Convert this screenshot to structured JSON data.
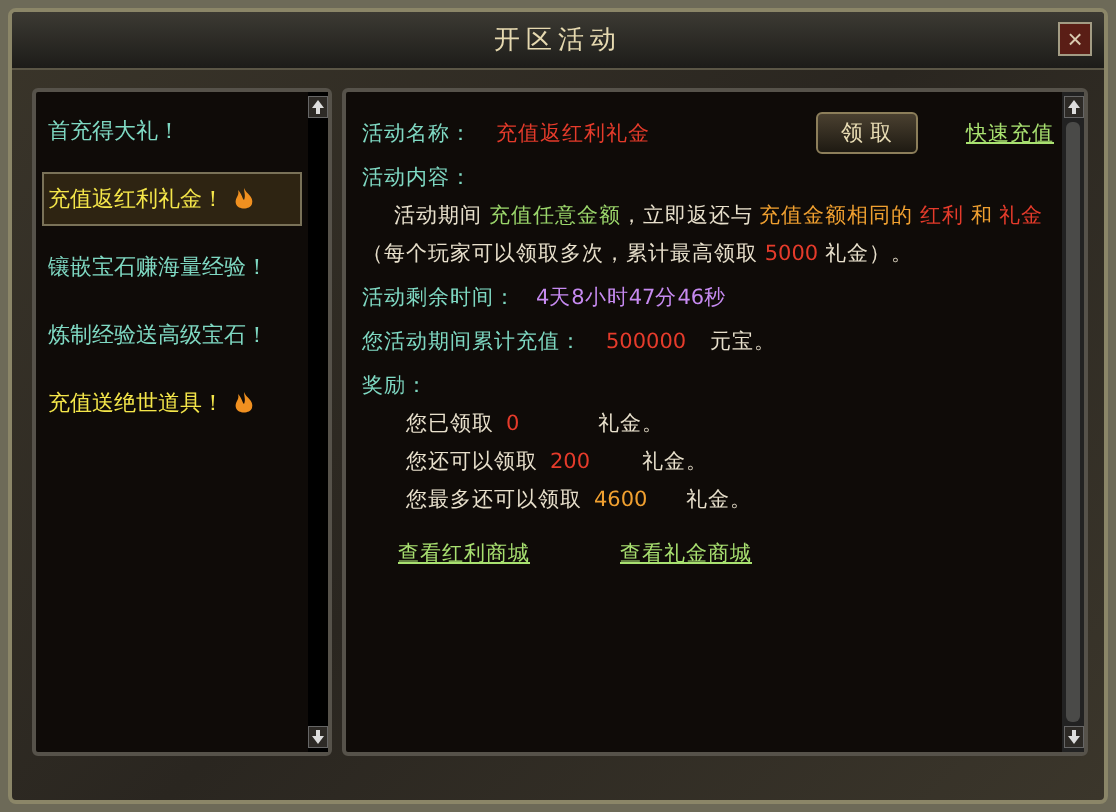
{
  "window": {
    "title": "开区活动",
    "close": "×"
  },
  "sidebar": {
    "items": [
      {
        "label": "首充得大礼！",
        "selected": false,
        "hot": false
      },
      {
        "label": "充值返红利礼金！",
        "selected": true,
        "hot": true
      },
      {
        "label": "镶嵌宝石赚海量经验！",
        "selected": false,
        "hot": false
      },
      {
        "label": "炼制经验送高级宝石！",
        "selected": false,
        "hot": false
      },
      {
        "label": "充值送绝世道具！",
        "selected": false,
        "hot": true
      }
    ]
  },
  "detail": {
    "name_label": "活动名称：",
    "name_value": "充值返红利礼金",
    "claim_button": "领 取",
    "quick_recharge": "快速充值",
    "content_label": "活动内容：",
    "content_lines": [
      [
        {
          "text": "活动期间 ",
          "kind": "plain"
        },
        {
          "text": "充值任意金额",
          "kind": "green"
        },
        {
          "text": "，立即返还与 ",
          "kind": "plain"
        },
        {
          "text": "充值金额相同的 ",
          "kind": "orange"
        },
        {
          "text": "红利",
          "kind": "red"
        },
        {
          "text": " 和 ",
          "kind": "orange"
        },
        {
          "text": "礼金",
          "kind": "red"
        }
      ],
      [
        {
          "text": "（每个玩家可以领取多次，累计最高领取 ",
          "kind": "plain"
        },
        {
          "text": "5000",
          "kind": "red"
        },
        {
          "text": " 礼金）。",
          "kind": "plain"
        }
      ]
    ],
    "time_label": "活动剩余时间：",
    "time_value": "4天8小时47分46秒",
    "total_label": "您活动期间累计充值：",
    "total_value": "500000",
    "total_unit": "元宝。",
    "rewards_label": "奖励：",
    "rewards": [
      {
        "label": "您已领取",
        "value": "0",
        "unit": "礼金。",
        "kind": "red"
      },
      {
        "label": "您还可以领取",
        "value": "200",
        "unit": "礼金。",
        "kind": "red"
      },
      {
        "label": "您最多还可以领取",
        "value": "4600",
        "unit": "礼金。",
        "kind": "orange"
      }
    ],
    "links": [
      "查看红利商城",
      "查看礼金商城"
    ]
  }
}
